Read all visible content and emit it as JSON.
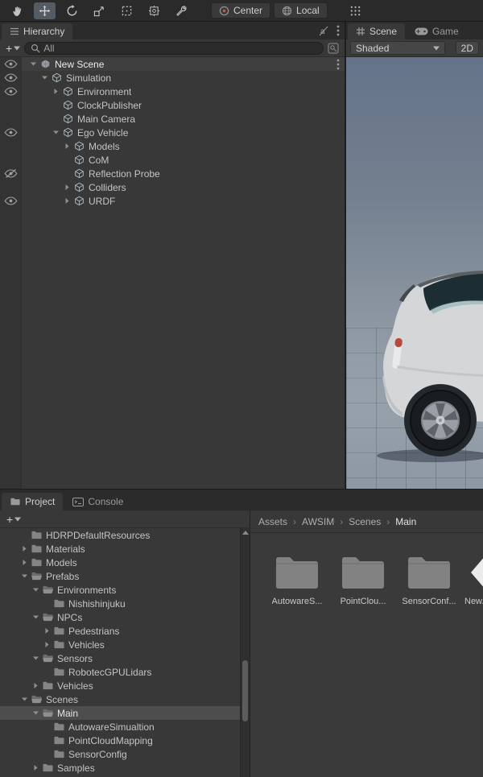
{
  "colors": {
    "panel": "#383838",
    "tabbar": "#2b2b2b",
    "selection_unfocused": "#4d4d4d",
    "sky_top": "#65738a",
    "sky_horizon": "#97a1ab"
  },
  "top_toolbar": {
    "tools": [
      {
        "name": "hand-tool",
        "icon": "hand",
        "selected": false
      },
      {
        "name": "move-tool",
        "icon": "move",
        "selected": true
      },
      {
        "name": "rotate-tool",
        "icon": "rotate",
        "selected": false
      },
      {
        "name": "scale-tool",
        "icon": "scale",
        "selected": false
      },
      {
        "name": "rect-tool",
        "icon": "rect",
        "selected": false
      },
      {
        "name": "transform-tool",
        "icon": "transform",
        "selected": false
      },
      {
        "name": "available-tools",
        "icon": "tools",
        "selected": false
      }
    ],
    "pivot_label": "Center",
    "orientation_label": "Local"
  },
  "hierarchy": {
    "tab_label": "Hierarchy",
    "search_placeholder": "All",
    "items": [
      {
        "label": "New Scene",
        "depth": 0,
        "arrow": "open",
        "icon": "scene",
        "eye": "on",
        "header": true,
        "kebab": true
      },
      {
        "label": "Simulation",
        "depth": 1,
        "arrow": "open",
        "icon": "cube",
        "eye": "on"
      },
      {
        "label": "Environment",
        "depth": 2,
        "arrow": "closed",
        "icon": "cube",
        "eye": "on"
      },
      {
        "label": "ClockPublisher",
        "depth": 2,
        "arrow": "none",
        "icon": "cube"
      },
      {
        "label": "Main Camera",
        "depth": 2,
        "arrow": "none",
        "icon": "cube"
      },
      {
        "label": "Ego Vehicle",
        "depth": 2,
        "arrow": "open",
        "icon": "cube",
        "eye": "on"
      },
      {
        "label": "Models",
        "depth": 3,
        "arrow": "closed",
        "icon": "cube"
      },
      {
        "label": "CoM",
        "depth": 3,
        "arrow": "none",
        "icon": "cube"
      },
      {
        "label": "Reflection Probe",
        "depth": 3,
        "arrow": "none",
        "icon": "cube",
        "eye": "off"
      },
      {
        "label": "Colliders",
        "depth": 3,
        "arrow": "closed",
        "icon": "cube"
      },
      {
        "label": "URDF",
        "depth": 3,
        "arrow": "closed",
        "icon": "cube",
        "eye": "on"
      }
    ]
  },
  "scene_view": {
    "tabs": [
      "Scene",
      "Game"
    ],
    "shading_mode": "Shaded",
    "mode_2d_label": "2D"
  },
  "bottom_panel": {
    "tabs": [
      "Project",
      "Console"
    ],
    "breadcrumb": [
      "Assets",
      "AWSIM",
      "Scenes",
      "Main"
    ],
    "tree": [
      {
        "label": "HDRPDefaultResources",
        "depth": 1,
        "arrow": "none",
        "icon": "folder"
      },
      {
        "label": "Materials",
        "depth": 1,
        "arrow": "closed",
        "icon": "folder"
      },
      {
        "label": "Models",
        "depth": 1,
        "arrow": "closed",
        "icon": "folder"
      },
      {
        "label": "Prefabs",
        "depth": 1,
        "arrow": "open",
        "icon": "folder-open"
      },
      {
        "label": "Environments",
        "depth": 2,
        "arrow": "open",
        "icon": "folder-open"
      },
      {
        "label": "Nishishinjuku",
        "depth": 3,
        "arrow": "none",
        "icon": "folder"
      },
      {
        "label": "NPCs",
        "depth": 2,
        "arrow": "open",
        "icon": "folder-open"
      },
      {
        "label": "Pedestrians",
        "depth": 3,
        "arrow": "closed",
        "icon": "folder"
      },
      {
        "label": "Vehicles",
        "depth": 3,
        "arrow": "closed",
        "icon": "folder"
      },
      {
        "label": "Sensors",
        "depth": 2,
        "arrow": "open",
        "icon": "folder-open"
      },
      {
        "label": "RobotecGPULidars",
        "depth": 3,
        "arrow": "none",
        "icon": "folder"
      },
      {
        "label": "Vehicles",
        "depth": 2,
        "arrow": "closed",
        "icon": "folder"
      },
      {
        "label": "Scenes",
        "depth": 1,
        "arrow": "open",
        "icon": "folder-open"
      },
      {
        "label": "Main",
        "depth": 2,
        "arrow": "open",
        "icon": "folder-open",
        "selected": true
      },
      {
        "label": "AutowareSimualtion",
        "depth": 3,
        "arrow": "none",
        "icon": "folder"
      },
      {
        "label": "PointCloudMapping",
        "depth": 3,
        "arrow": "none",
        "icon": "folder"
      },
      {
        "label": "SensorConfig",
        "depth": 3,
        "arrow": "none",
        "icon": "folder"
      },
      {
        "label": "Samples",
        "depth": 2,
        "arrow": "closed",
        "icon": "folder"
      }
    ],
    "tiles": [
      {
        "label": "AutowareS...",
        "icon": "folder-large"
      },
      {
        "label": "PointClou...",
        "icon": "folder-large"
      },
      {
        "label": "SensorConf...",
        "icon": "folder-large"
      },
      {
        "label": "New...",
        "icon": "unity-asset"
      }
    ]
  }
}
